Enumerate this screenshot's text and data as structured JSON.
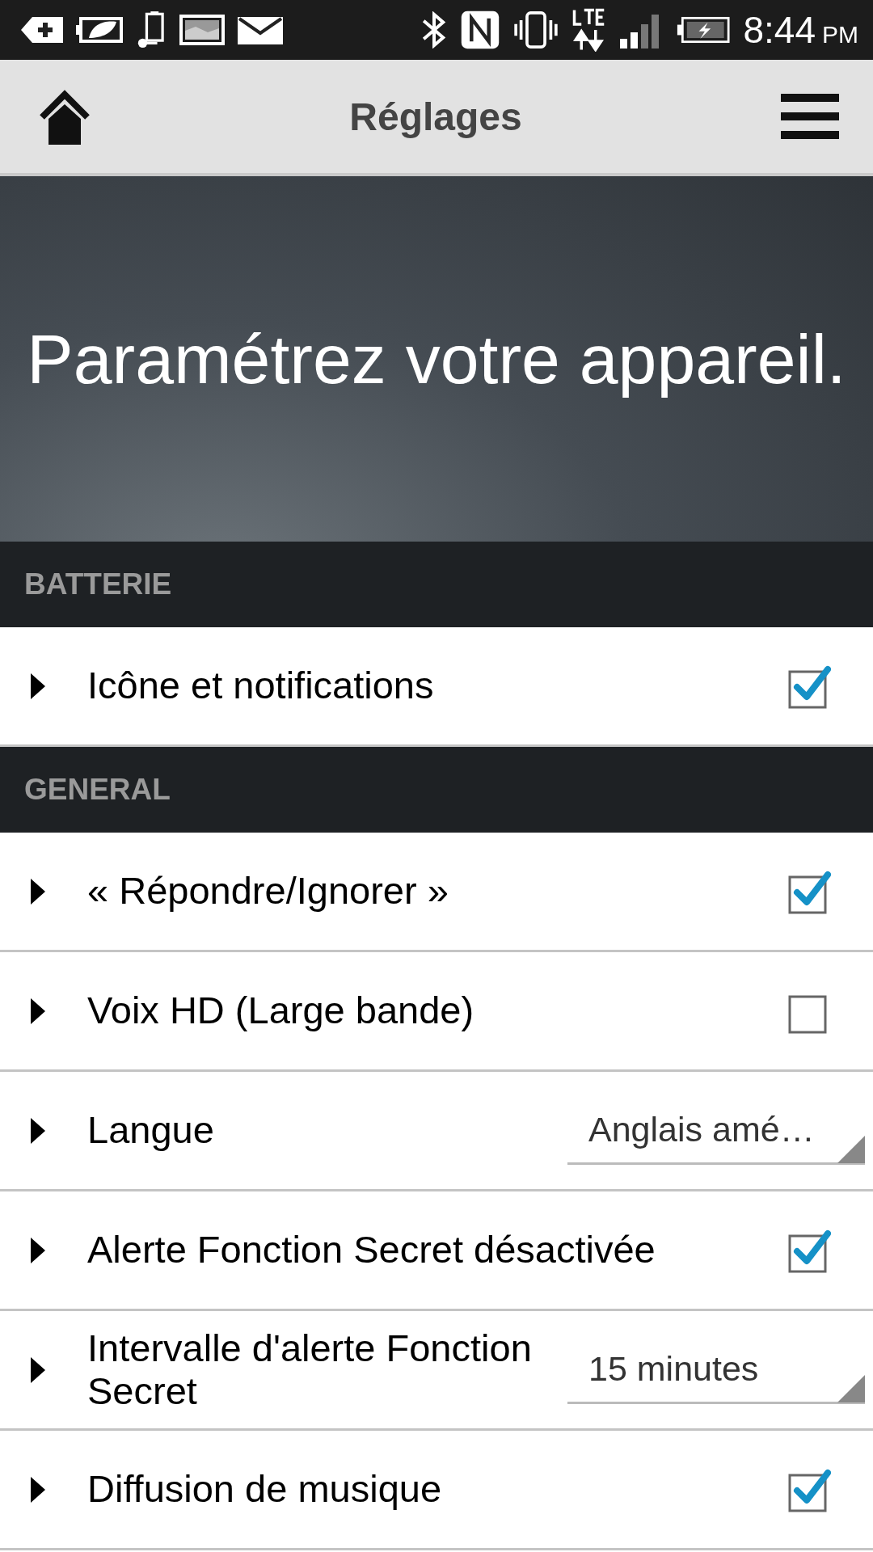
{
  "status_bar": {
    "time": "8:44",
    "ampm": "PM"
  },
  "header": {
    "title": "Réglages"
  },
  "hero": {
    "text": "Paramétrez votre appareil."
  },
  "sections": [
    {
      "title": "BATTERIE",
      "rows": [
        {
          "kind": "checkbox",
          "label": "Icône et notifications",
          "checked": true
        }
      ]
    },
    {
      "title": "GENERAL",
      "rows": [
        {
          "kind": "checkbox",
          "label": "« Répondre/Ignorer »",
          "checked": true
        },
        {
          "kind": "checkbox",
          "label": "Voix HD (Large bande)",
          "checked": false
        },
        {
          "kind": "dropdown",
          "label": "Langue",
          "value": "Anglais amé…"
        },
        {
          "kind": "checkbox",
          "label": "Alerte Fonction Secret désactivée",
          "checked": true
        },
        {
          "kind": "dropdown",
          "label": "Intervalle d'alerte Fonction Secret",
          "value": "15 minutes"
        },
        {
          "kind": "checkbox",
          "label": "Diffusion de musique",
          "checked": true
        }
      ]
    }
  ]
}
